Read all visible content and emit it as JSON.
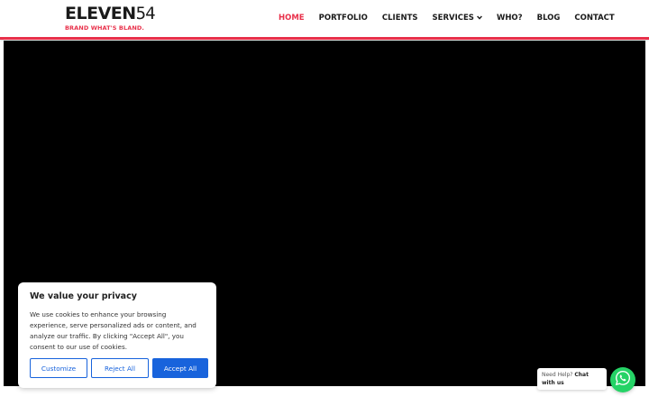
{
  "brand": {
    "name": "ELEVEN",
    "number": "54",
    "tagline": "BRAND WHAT'S BLAND.",
    "accent_color": "#e8304a"
  },
  "nav": {
    "items": [
      {
        "label": "HOME",
        "active": true
      },
      {
        "label": "PORTFOLIO"
      },
      {
        "label": "CLIENTS"
      },
      {
        "label": "SERVICES",
        "icon": "chevron-down-icon"
      },
      {
        "label": "WHO?"
      },
      {
        "label": "BLOG"
      },
      {
        "label": "CONTACT"
      }
    ]
  },
  "cookie_banner": {
    "title": "We value your privacy",
    "text": "We use cookies to enhance your browsing experience, serve personalized ads or content, and analyze our traffic. By clicking \"Accept All\", you consent to our use of cookies.",
    "customize_label": "Customize",
    "reject_label": "Reject All",
    "accept_label": "Accept All",
    "button_color": "#1863dc"
  },
  "chat": {
    "prefix": "Need Help?",
    "link": "Chat with us",
    "icon": "whatsapp-icon",
    "color": "#25d366"
  }
}
